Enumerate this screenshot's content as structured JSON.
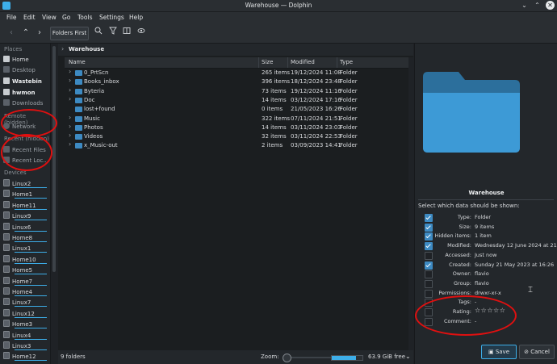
{
  "window": {
    "title": "Warehouse — Dolphin"
  },
  "menu": [
    "File",
    "Edit",
    "View",
    "Go",
    "Tools",
    "Settings",
    "Help"
  ],
  "toolbar": {
    "folders_first": "Folders First"
  },
  "sidebar": {
    "places_header": "Places",
    "places": [
      {
        "label": "Home",
        "style": "normal"
      },
      {
        "label": "Desktop",
        "style": "dim"
      },
      {
        "label": "Wastebin",
        "style": "bold"
      },
      {
        "label": "hwmon",
        "style": "bold"
      },
      {
        "label": "Downloads",
        "style": "dim"
      }
    ],
    "remote_header": "Remote (hidden)",
    "remote": [
      {
        "label": "Network"
      }
    ],
    "recent_header": "Recent (hidden)",
    "recent": [
      {
        "label": "Recent Files"
      },
      {
        "label": "Recent Loc..."
      }
    ],
    "devices_header": "Devices",
    "devices": [
      "Linux2",
      "Home1",
      "Home11",
      "Linux9",
      "Linux6",
      "Home8",
      "Linux1",
      "Home10",
      "Home5",
      "Home7",
      "Home4",
      "Linux7",
      "Linux12",
      "Home3",
      "Linux4",
      "Linux3",
      "Home12"
    ]
  },
  "breadcrumb": {
    "current": "Warehouse"
  },
  "columns": {
    "name": "Name",
    "size": "Size",
    "modified": "Modified",
    "type": "Type"
  },
  "files": [
    {
      "name": "0_PrtScn",
      "size": "265 items",
      "modified": "19/12/2024 11:08",
      "type": "Folder",
      "expandable": true
    },
    {
      "name": "Books_inbox",
      "size": "396 items",
      "modified": "18/12/2024 23:48",
      "type": "Folder",
      "expandable": true
    },
    {
      "name": "Byteria",
      "size": "73 items",
      "modified": "19/12/2024 11:16",
      "type": "Folder",
      "expandable": true
    },
    {
      "name": "Doc",
      "size": "14 items",
      "modified": "03/12/2024 17:16",
      "type": "Folder",
      "expandable": true
    },
    {
      "name": "lost+found",
      "size": "0 items",
      "modified": "21/05/2023 16:26",
      "type": "Folder",
      "expandable": false
    },
    {
      "name": "Music",
      "size": "322 items",
      "modified": "07/11/2024 21:51",
      "type": "Folder",
      "expandable": true
    },
    {
      "name": "Photos",
      "size": "14 items",
      "modified": "03/11/2024 23:03",
      "type": "Folder",
      "expandable": true
    },
    {
      "name": "Videos",
      "size": "32 items",
      "modified": "03/11/2024 22:53",
      "type": "Folder",
      "expandable": true
    },
    {
      "name": "x_Music-out",
      "size": "2 items",
      "modified": "03/09/2023 14:41",
      "type": "Folder",
      "expandable": true
    }
  ],
  "status": {
    "count": "9 folders",
    "zoom_label": "Zoom:",
    "zoom_level": 0.05,
    "free": "63.9 GiB free",
    "free_fraction": 0.8
  },
  "info": {
    "title": "Warehouse",
    "prompt": "Select which data should be shown:",
    "fields": [
      {
        "key": "Type:",
        "value": "Folder",
        "checked": true
      },
      {
        "key": "Size:",
        "value": "9 items",
        "checked": true
      },
      {
        "key": "Hidden items:",
        "value": "1 item",
        "checked": true
      },
      {
        "key": "Modified:",
        "value": "Wednesday 12 June 2024 at 21:23",
        "checked": true
      },
      {
        "key": "Accessed:",
        "value": "Just now",
        "checked": false
      },
      {
        "key": "Created:",
        "value": "Sunday 21 May 2023 at 16:26",
        "checked": true
      },
      {
        "key": "Owner:",
        "value": "flavio",
        "checked": false
      },
      {
        "key": "Group:",
        "value": "flavio",
        "checked": false
      },
      {
        "key": "Permissions:",
        "value": "drwxr-xr-x",
        "checked": false
      },
      {
        "key": "Tags:",
        "value": "-",
        "checked": false
      },
      {
        "key": "Rating:",
        "value": "☆☆☆☆☆",
        "checked": false
      },
      {
        "key": "Comment:",
        "value": "-",
        "checked": false
      }
    ],
    "save": "Save",
    "cancel": "Cancel"
  },
  "colors": {
    "accent": "#3daee9",
    "folder": "#3d8ac2",
    "annotation": "#e01010"
  }
}
